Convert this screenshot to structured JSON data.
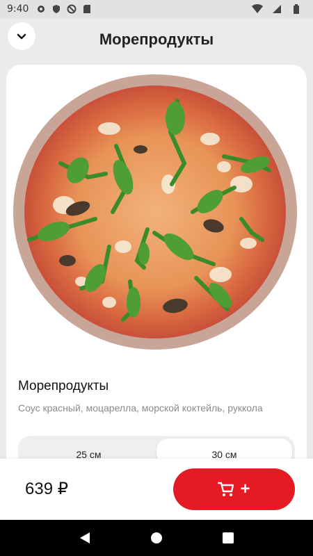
{
  "status_bar": {
    "time": "9:40",
    "icons": [
      "settings-icon",
      "shield-icon",
      "at-icon",
      "sd-card-icon",
      "wifi-icon",
      "signal-icon",
      "battery-icon"
    ]
  },
  "header": {
    "title": "Морепродукты",
    "back_icon": "chevron-down-icon"
  },
  "product": {
    "name": "Морепродукты",
    "description": "Соус красный, моцарелла, морской коктейль, руккола",
    "image": "pizza-image"
  },
  "sizes": {
    "options": [
      "25 см",
      "30 см"
    ],
    "selected": "30 см"
  },
  "footer": {
    "price": "639 ₽",
    "add_icon": "cart-icon",
    "add_plus": "+"
  },
  "colors": {
    "accent": "#e51a24",
    "background": "#ebebeb",
    "card": "#ffffff"
  },
  "nav": [
    "back-icon",
    "home-icon",
    "recents-icon"
  ]
}
